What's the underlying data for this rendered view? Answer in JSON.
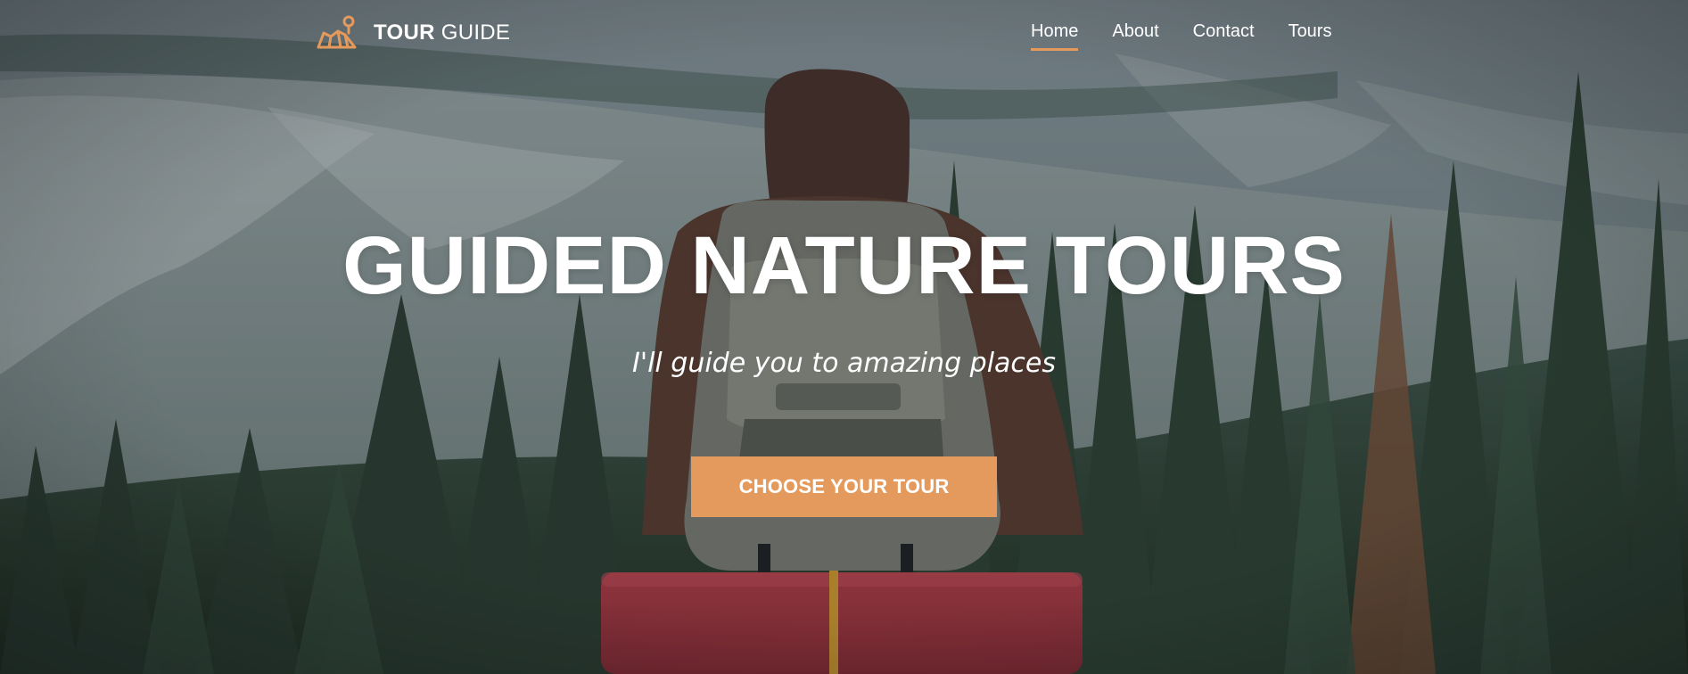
{
  "header": {
    "logo": {
      "bold": "TOUR",
      "light": "GUIDE",
      "icon": "map-pin-icon"
    },
    "nav": [
      {
        "label": "Home",
        "active": true
      },
      {
        "label": "About",
        "active": false
      },
      {
        "label": "Contact",
        "active": false
      },
      {
        "label": "Tours",
        "active": false
      }
    ]
  },
  "hero": {
    "title": "GUIDED NATURE TOURS",
    "subtitle": "I'll guide you to amazing places",
    "cta_label": "CHOOSE YOUR TOUR",
    "background": "hiker-with-backpack-forest-mountains"
  },
  "colors": {
    "accent": "#e59a5d",
    "text": "#ffffff"
  }
}
